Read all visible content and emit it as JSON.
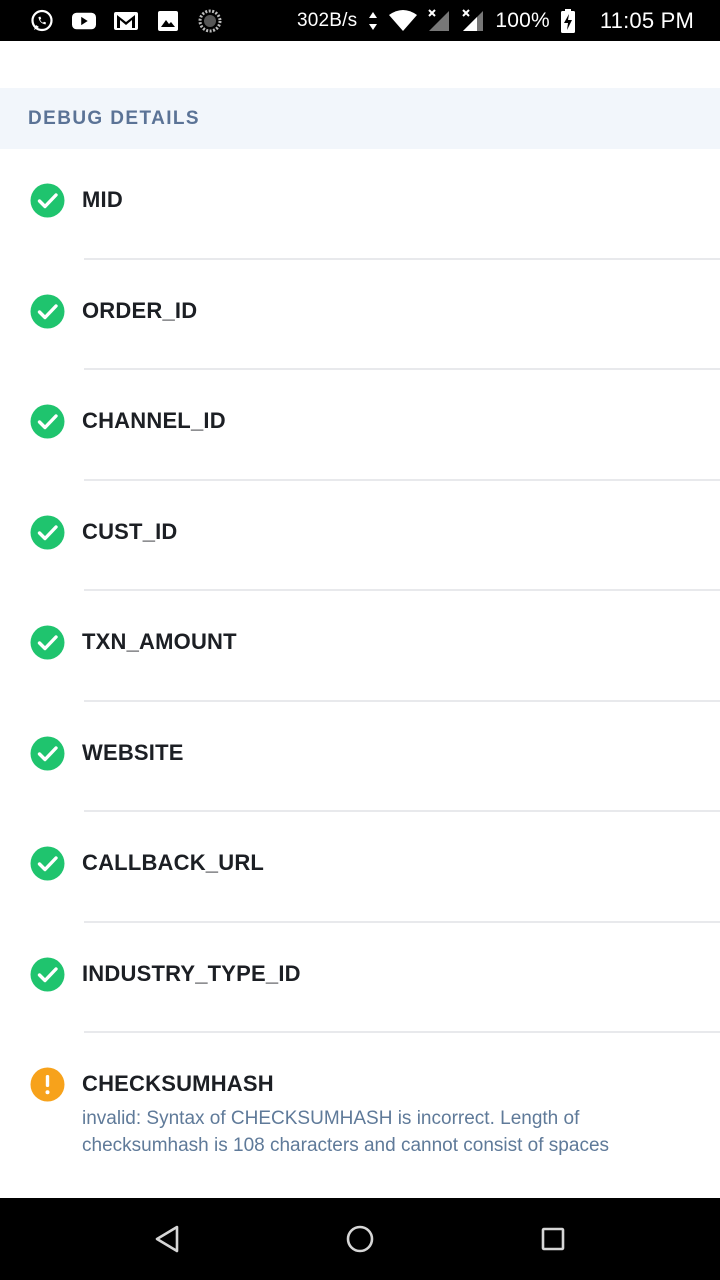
{
  "status_bar": {
    "net_speed": "302B/s",
    "battery": "100%",
    "time": "11:05 PM",
    "left_icons": [
      "whatsapp-icon",
      "youtube-icon",
      "gmail-icon",
      "gallery-icon",
      "loading-icon"
    ],
    "right_icons": [
      "data-arrows-icon",
      "wifi-icon",
      "signal-icon",
      "signal-icon",
      "battery-charging-icon"
    ]
  },
  "section": {
    "title": "DEBUG DETAILS"
  },
  "items": [
    {
      "label": "MID",
      "status": "ok"
    },
    {
      "label": "ORDER_ID",
      "status": "ok"
    },
    {
      "label": "CHANNEL_ID",
      "status": "ok"
    },
    {
      "label": "CUST_ID",
      "status": "ok"
    },
    {
      "label": "TXN_AMOUNT",
      "status": "ok"
    },
    {
      "label": "WEBSITE",
      "status": "ok"
    },
    {
      "label": "CALLBACK_URL",
      "status": "ok"
    },
    {
      "label": "INDUSTRY_TYPE_ID",
      "status": "ok"
    },
    {
      "label": "CHECKSUMHASH",
      "status": "warning",
      "message": "invalid: Syntax of CHECKSUMHASH is incorrect. Length of checksumhash is 108 characters and cannot consist of spaces"
    }
  ],
  "colors": {
    "ok": "#1fc46e",
    "warning": "#f7a21b",
    "header_bg": "#f2f6fb",
    "header_text": "#5b7396",
    "message_text": "#5f7a99"
  },
  "nav_bar": {
    "buttons": [
      "back-icon",
      "home-icon",
      "recents-icon"
    ]
  }
}
